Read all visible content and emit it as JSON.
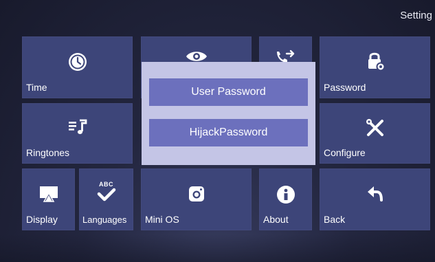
{
  "header": {
    "title": "Setting"
  },
  "tiles": {
    "time": {
      "label": "Time",
      "icon": "clock-icon"
    },
    "view": {
      "label": "",
      "icon": "eye-icon"
    },
    "call_forward": {
      "label": "",
      "icon": "call-forward-icon"
    },
    "password": {
      "label": "Password",
      "icon": "lock-gear-icon"
    },
    "ringtones": {
      "label": "Ringtones",
      "icon": "music-list-icon"
    },
    "configure": {
      "label": "Configure",
      "icon": "tools-icon"
    },
    "display": {
      "label": "Display",
      "icon": "display-icon"
    },
    "languages": {
      "label": "Languages",
      "icon": "abc-check-icon",
      "icon_text": "ABC"
    },
    "mini_os": {
      "label": "Mini OS",
      "icon": "instagram-icon"
    },
    "about": {
      "label": "About",
      "icon": "info-icon"
    },
    "back": {
      "label": "Back",
      "icon": "back-arrow-icon"
    }
  },
  "password_dialog": {
    "user_password": "User Password",
    "hijack_password": "HijackPassword"
  },
  "colors": {
    "tile": "#3d4579",
    "dialog": "#c4c5e6",
    "dialog_button": "#6c70bd",
    "background": "#1e2136"
  }
}
